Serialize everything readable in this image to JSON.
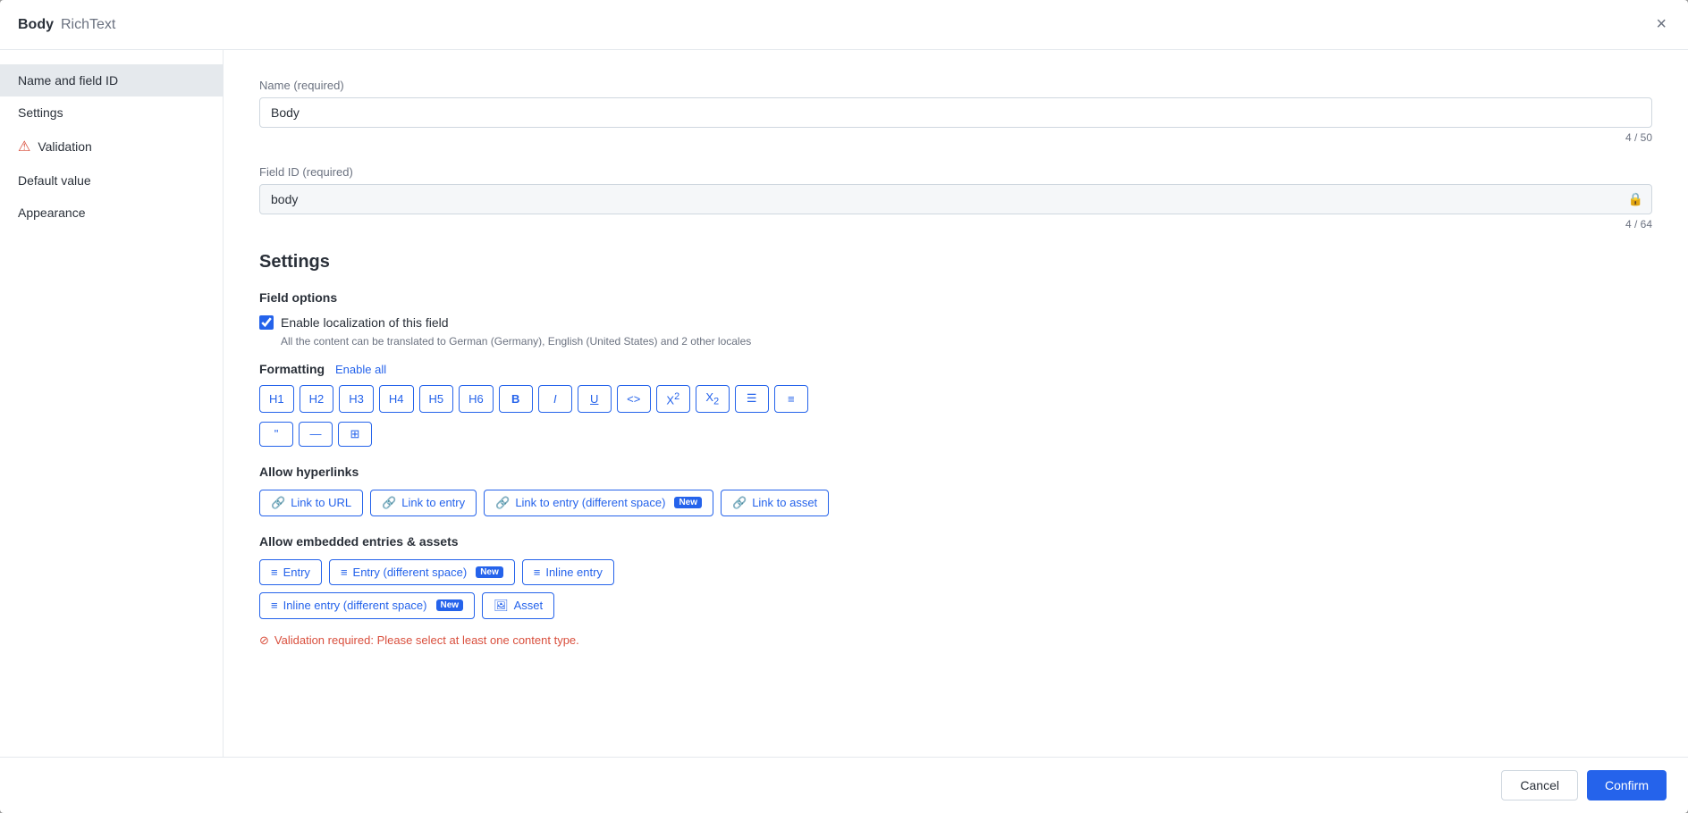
{
  "modal": {
    "title": "Body",
    "title_type": "RichText",
    "close_label": "×"
  },
  "sidebar": {
    "items": [
      {
        "id": "name-and-field-id",
        "label": "Name and field ID",
        "active": true,
        "error": false
      },
      {
        "id": "settings",
        "label": "Settings",
        "active": false,
        "error": false
      },
      {
        "id": "validation",
        "label": "Validation",
        "active": false,
        "error": true
      },
      {
        "id": "default-value",
        "label": "Default value",
        "active": false,
        "error": false
      },
      {
        "id": "appearance",
        "label": "Appearance",
        "active": false,
        "error": false
      }
    ]
  },
  "form": {
    "name_label": "Name",
    "name_required": "(required)",
    "name_value": "Body",
    "name_char_count": "4 / 50",
    "field_id_label": "Field ID",
    "field_id_required": "(required)",
    "field_id_value": "body",
    "field_id_char_count": "4 / 64"
  },
  "settings": {
    "section_title": "Settings",
    "field_options_title": "Field options",
    "localization_label": "Enable localization of this field",
    "localization_hint": "All the content can be translated to German (Germany), English (United States) and 2 other locales",
    "formatting_label": "Formatting",
    "enable_all_label": "Enable all",
    "formatting_buttons": [
      {
        "id": "h1",
        "label": "H1"
      },
      {
        "id": "h2",
        "label": "H2"
      },
      {
        "id": "h3",
        "label": "H3"
      },
      {
        "id": "h4",
        "label": "H4"
      },
      {
        "id": "h5",
        "label": "H5"
      },
      {
        "id": "h6",
        "label": "H6"
      },
      {
        "id": "bold",
        "label": "B",
        "style": "bold"
      },
      {
        "id": "italic",
        "label": "I",
        "style": "italic"
      },
      {
        "id": "underline",
        "label": "U",
        "style": "underline"
      },
      {
        "id": "code",
        "label": "<>"
      },
      {
        "id": "superscript",
        "label": "X²"
      },
      {
        "id": "subscript",
        "label": "X₂"
      },
      {
        "id": "ul",
        "label": "≡"
      },
      {
        "id": "ol",
        "label": "≡₂"
      }
    ],
    "formatting_buttons_row2": [
      {
        "id": "quote",
        "label": "❝"
      },
      {
        "id": "hr",
        "label": "—"
      },
      {
        "id": "table",
        "label": "⊞"
      }
    ],
    "allow_hyperlinks_title": "Allow hyperlinks",
    "hyperlink_buttons": [
      {
        "id": "link-to-url",
        "label": "Link to URL",
        "new": false
      },
      {
        "id": "link-to-entry",
        "label": "Link to entry",
        "new": false
      },
      {
        "id": "link-to-entry-diff-space",
        "label": "Link to entry (different space)",
        "new": true
      },
      {
        "id": "link-to-asset",
        "label": "Link to asset",
        "new": false
      }
    ],
    "allow_embedded_title": "Allow embedded entries & assets",
    "embedded_buttons_row1": [
      {
        "id": "entry",
        "label": "Entry",
        "new": false
      },
      {
        "id": "entry-diff-space",
        "label": "Entry (different space)",
        "new": true
      },
      {
        "id": "inline-entry",
        "label": "Inline entry",
        "new": false
      }
    ],
    "embedded_buttons_row2": [
      {
        "id": "inline-entry-diff-space",
        "label": "Inline entry (different space)",
        "new": true
      },
      {
        "id": "asset",
        "label": "Asset",
        "new": false
      }
    ],
    "validation_error": "Validation required: Please select at least one content type."
  },
  "footer": {
    "cancel_label": "Cancel",
    "confirm_label": "Confirm"
  }
}
